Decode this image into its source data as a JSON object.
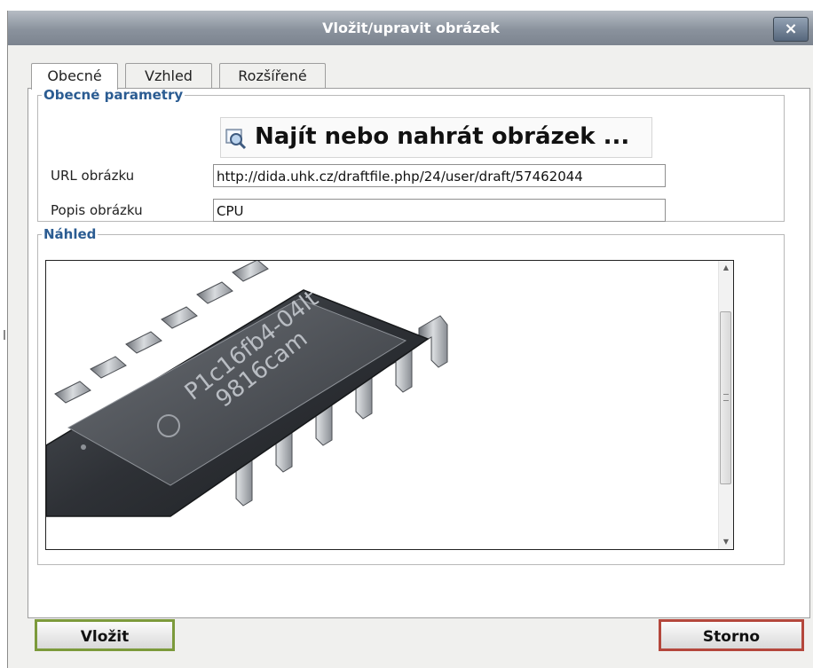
{
  "dialog": {
    "title": "Vložit/upravit obrázek",
    "close_icon": "close-icon",
    "close_label": "×"
  },
  "tabs": [
    {
      "label": "Obecné",
      "active": true
    },
    {
      "label": "Vzhled",
      "active": false
    },
    {
      "label": "Rozšířené",
      "active": false
    }
  ],
  "general": {
    "legend": "Obecné parametry",
    "find_button": {
      "label": "Najít nebo nahrát obrázek ...",
      "icon": "magnifier-image-icon"
    },
    "url": {
      "label": "URL obrázku",
      "value": "http://dida.uhk.cz/draftfile.php/24/user/draft/57462044"
    },
    "description": {
      "label": "Popis obrázku",
      "value": "CPU"
    }
  },
  "preview": {
    "legend": "Náhled",
    "image_icon": "microchip-image",
    "chip_text_line1": "P1c16fb4-04lt",
    "chip_text_line2": "9816cam"
  },
  "buttons": {
    "insert": "Vložit",
    "cancel": "Storno"
  },
  "colors": {
    "legend_text": "#2b5c92",
    "insert_border": "#7c9a3b",
    "cancel_border": "#b4473c",
    "titlebar": "#8a929d"
  }
}
